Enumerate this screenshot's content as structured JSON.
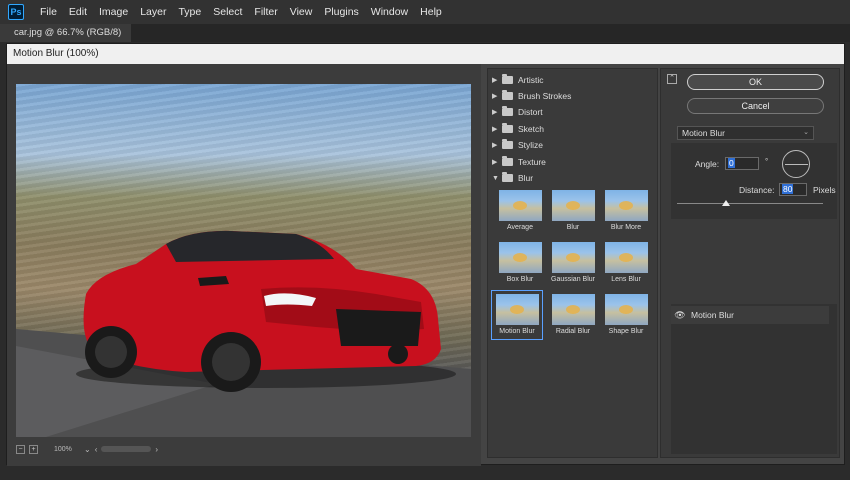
{
  "menubar": {
    "items": [
      "File",
      "Edit",
      "Image",
      "Layer",
      "Type",
      "Select",
      "Filter",
      "View",
      "Plugins",
      "Window",
      "Help"
    ],
    "logo": "Ps"
  },
  "document_tab": {
    "label": "car.jpg @ 66.7% (RGB/8)"
  },
  "dialog": {
    "title": "Motion Blur (100%)",
    "zoom": "100%"
  },
  "gallery": {
    "categories": [
      "Artistic",
      "Brush Strokes",
      "Distort",
      "Sketch",
      "Stylize",
      "Texture",
      "Blur"
    ],
    "blur_thumbnails": [
      "Average",
      "Blur",
      "Blur More",
      "Box Blur",
      "Gaussian Blur",
      "Lens Blur",
      "Motion Blur",
      "Radial Blur",
      "Shape Blur"
    ],
    "selected": "Motion Blur"
  },
  "options": {
    "ok_label": "OK",
    "cancel_label": "Cancel",
    "filter_select": "Motion Blur",
    "angle_label": "Angle:",
    "angle_value": "0",
    "degree_symbol": "°",
    "distance_label": "Distance:",
    "distance_value": "80",
    "distance_unit": "Pixels",
    "effect_layer": "Motion Blur"
  },
  "colors": {
    "accent": "#5aa0ff",
    "selection": "#2f6fd6"
  }
}
